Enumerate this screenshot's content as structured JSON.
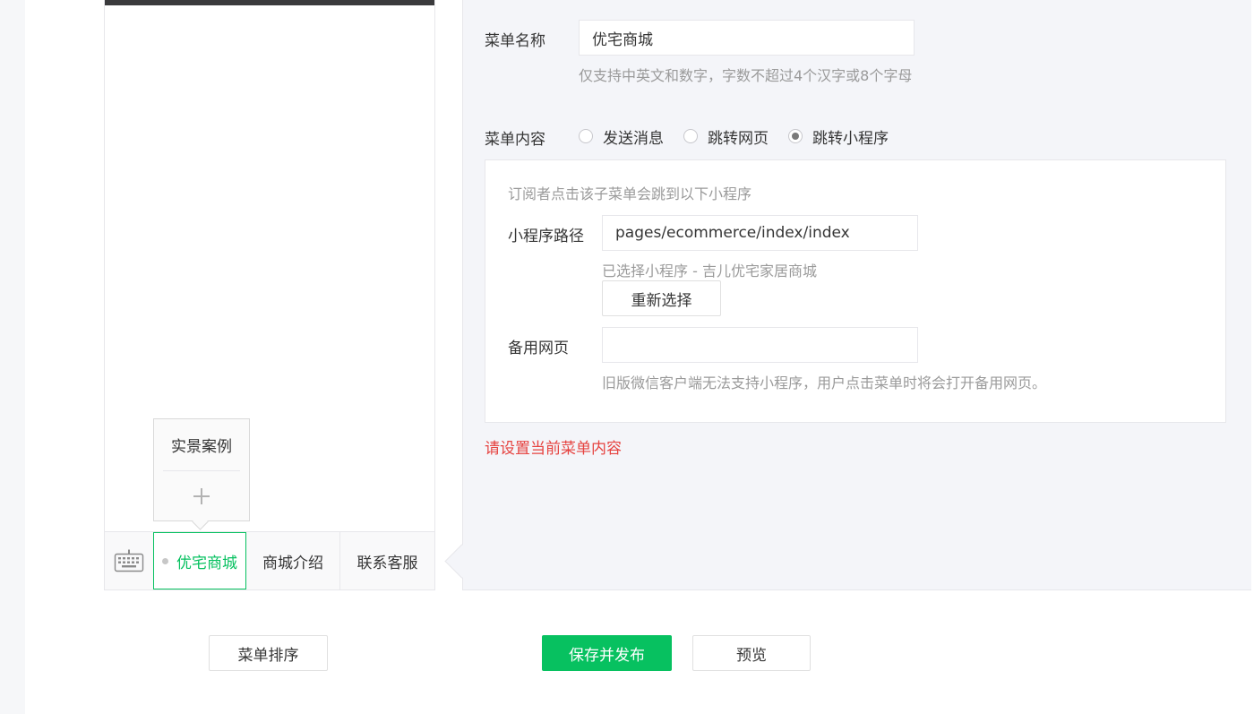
{
  "phone_preview": {
    "submenu_items": [
      "实景案例"
    ],
    "menu_tabs": [
      "优宅商城",
      "商城介绍",
      "联系客服"
    ]
  },
  "editor": {
    "menu_name_label": "菜单名称",
    "menu_name_value": "优宅商城",
    "menu_name_tip": "仅支持中英文和数字，字数不超过4个汉字或8个字母",
    "menu_content_label": "菜单内容",
    "content_options": [
      {
        "label": "发送消息",
        "selected": false
      },
      {
        "label": "跳转网页",
        "selected": false
      },
      {
        "label": "跳转小程序",
        "selected": true
      }
    ],
    "miniprogram": {
      "description": "订阅者点击该子菜单会跳到以下小程序",
      "path_label": "小程序路径",
      "path_value": "pages/ecommerce/index/index",
      "selected_text": "已选择小程序 - 吉儿优宅家居商城",
      "reselect_button": "重新选择",
      "backup_label": "备用网页",
      "backup_value": "",
      "backup_tip": "旧版微信客户端无法支持小程序，用户点击菜单时将会打开备用网页。"
    },
    "error_text": "请设置当前菜单内容"
  },
  "footer": {
    "sort_button": "菜单排序",
    "save_button": "保存并发布",
    "preview_button": "预览"
  },
  "colors": {
    "accent": "#07c160",
    "error": "#e64340"
  }
}
